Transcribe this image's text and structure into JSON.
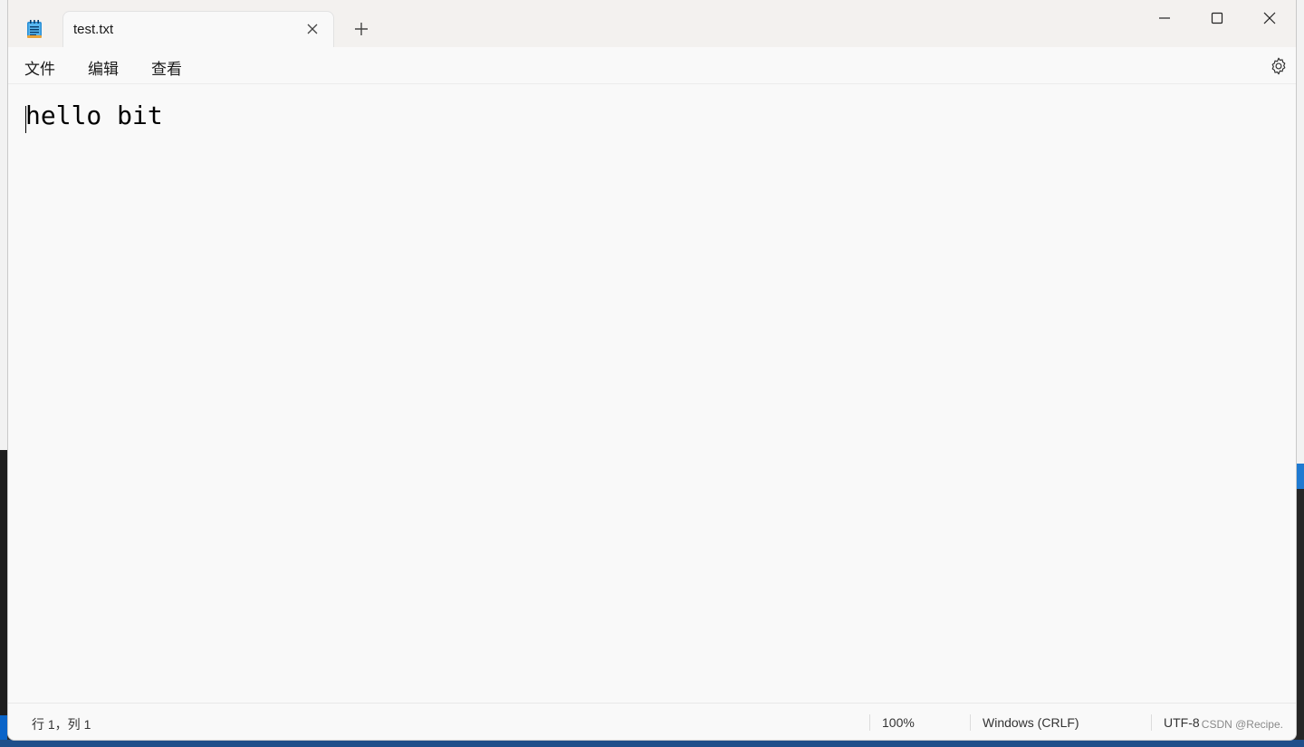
{
  "tab": {
    "title": "test.txt"
  },
  "menu": {
    "items": [
      "文件",
      "编辑",
      "查看"
    ]
  },
  "editor": {
    "content": "hello bit"
  },
  "status": {
    "position": "行 1，列 1",
    "zoom": "100%",
    "line_ending": "Windows (CRLF)",
    "encoding": "UTF-8"
  },
  "watermark": "CSDN @Recipe.",
  "icons": {
    "app": "notepad-icon",
    "tab_close": "close-icon",
    "new_tab": "plus-icon",
    "minimize": "minimize-icon",
    "maximize": "maximize-icon",
    "close": "close-icon",
    "settings": "gear-icon"
  },
  "colors": {
    "window_bg": "#f9f9f9",
    "titlebar_bg": "#f3f1ef",
    "text": "#1a1a1a"
  }
}
